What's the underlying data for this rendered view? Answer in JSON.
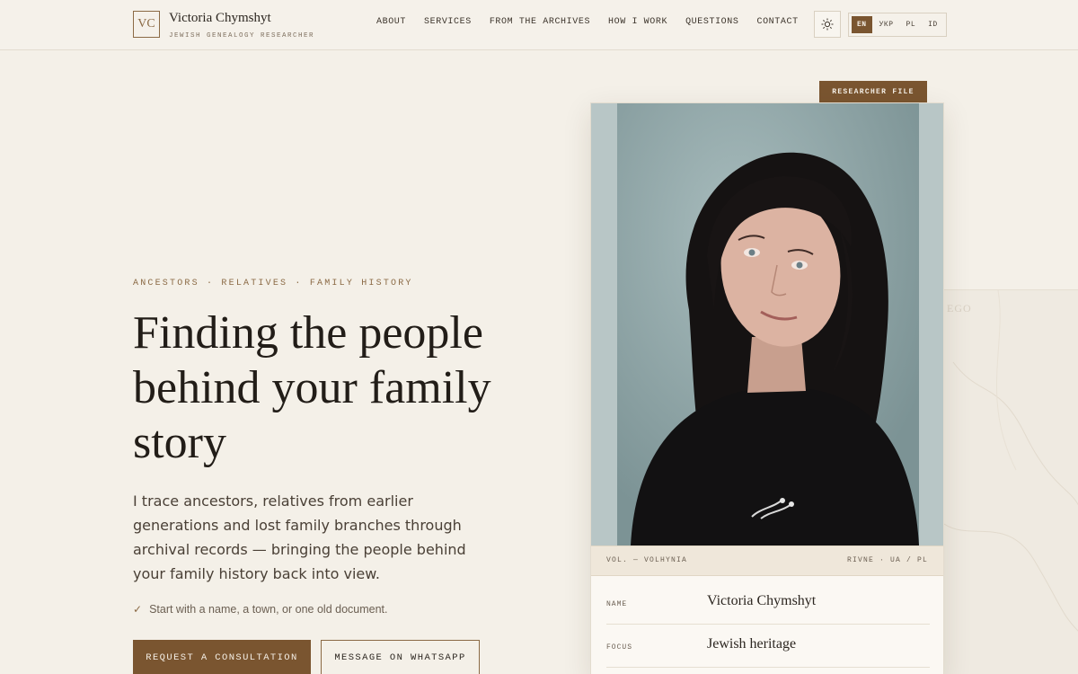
{
  "brand": {
    "monogram": "VC",
    "name": "Victoria Chymshyt",
    "tagline": "JEWISH GENEALOGY RESEARCHER"
  },
  "nav": {
    "items": [
      {
        "label": "ABOUT"
      },
      {
        "label": "SERVICES"
      },
      {
        "label": "FROM THE ARCHIVES"
      },
      {
        "label": "HOW I WORK"
      },
      {
        "label": "QUESTIONS"
      },
      {
        "label": "CONTACT"
      }
    ],
    "theme_icon": "sun-icon",
    "languages": [
      "EN",
      "УКР",
      "PL",
      "ID"
    ],
    "active_language": "EN"
  },
  "hero": {
    "eyebrow": "ANCESTORS · RELATIVES · FAMILY HISTORY",
    "headline": "Finding the people behind your family story",
    "lede": "I trace ancestors, relatives from earlier generations and lost family branches through archival records — bringing the people behind your family history back into view.",
    "note": "Start with a name, a town, or one old document.",
    "primary_button": "REQUEST A CONSULTATION",
    "secondary_button": "MESSAGE ON WHATSAPP"
  },
  "card": {
    "tab": "RESEARCHER FILE",
    "meta_left": "VOL. — VOLHYNIA",
    "meta_right": "RIVNE · UA / PL",
    "rows": [
      {
        "label": "NAME",
        "value": "Victoria Chymshyt"
      },
      {
        "label": "FOCUS",
        "value": "Jewish heritage"
      }
    ]
  },
  "map": {
    "label": "EGO"
  },
  "colors": {
    "accent": "#7a5530",
    "background": "#f4f0e8",
    "text": "#2c2620"
  }
}
